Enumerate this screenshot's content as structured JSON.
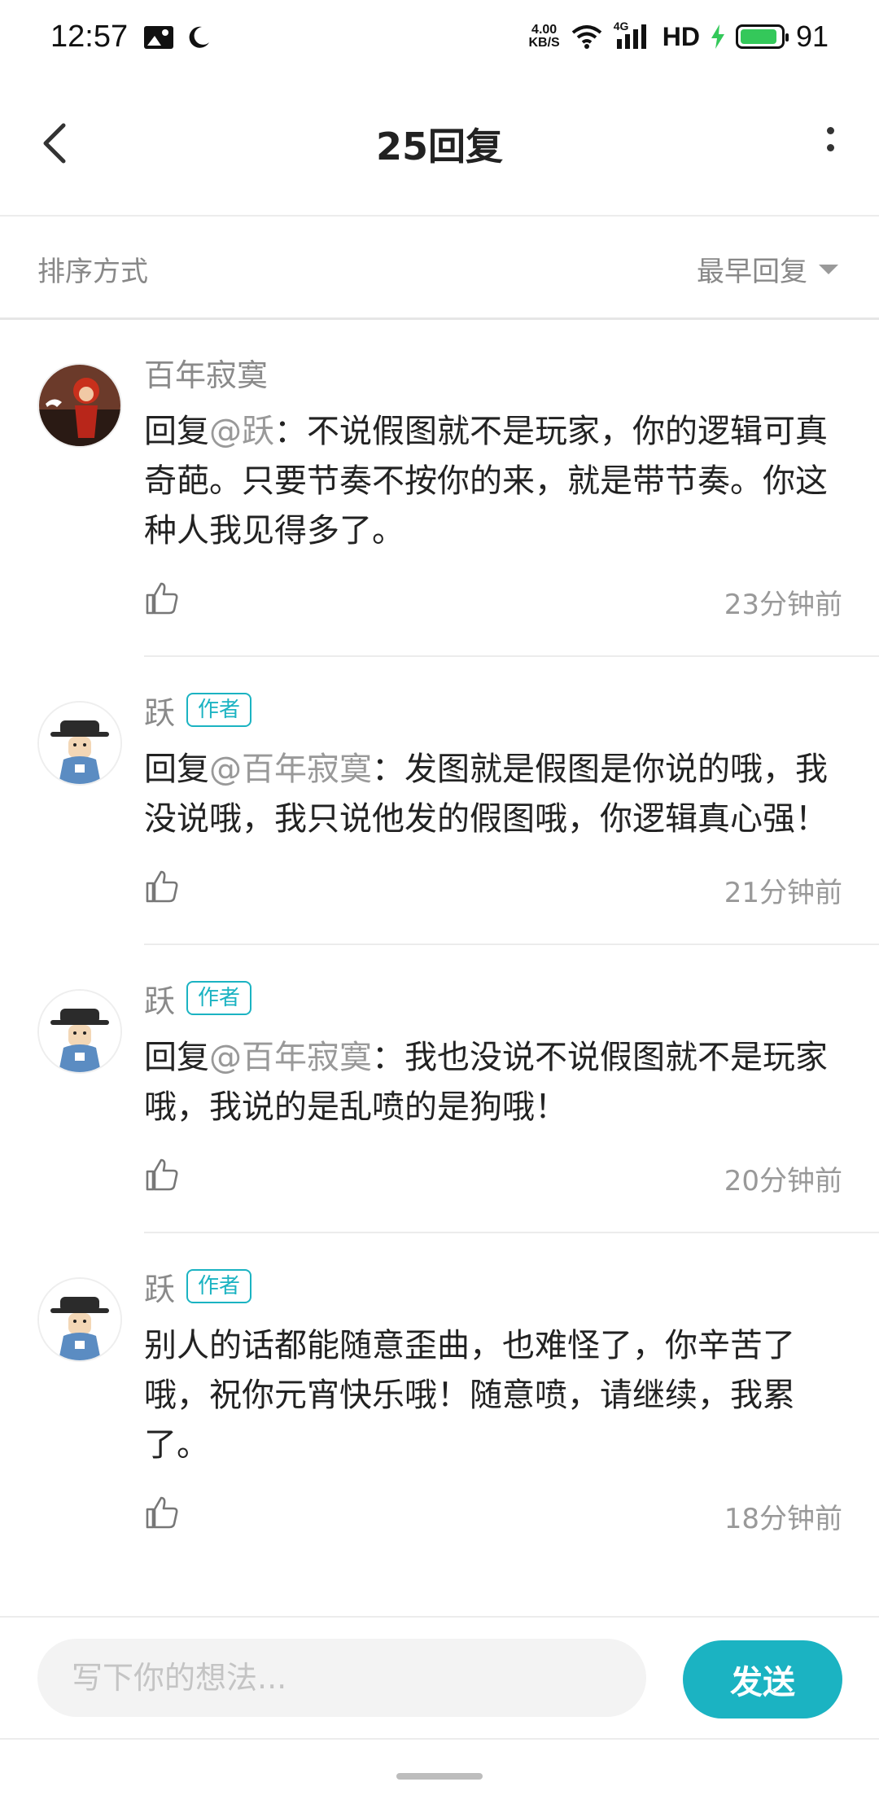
{
  "status_bar": {
    "time": "12:57",
    "net_speed_value": "4.00",
    "net_speed_unit": "KB/S",
    "network": "4G",
    "hd": "HD",
    "battery": "91"
  },
  "header": {
    "title": "25回复"
  },
  "sort": {
    "label": "排序方式",
    "value": "最早回复"
  },
  "comments": [
    {
      "author": "百年寂寞",
      "badge": "",
      "prefix": "回复",
      "mention": "@跃",
      "text": "：不说假图就不是玩家，你的逻辑可真奇葩。只要节奏不按你的来，就是带节奏。你这种人我见得多了。",
      "time": "23分钟前"
    },
    {
      "author": "跃",
      "badge": "作者",
      "prefix": "回复",
      "mention": "@百年寂寞",
      "text": "：发图就是假图是你说的哦，我没说哦，我只说他发的假图哦，你逻辑真心强！",
      "time": "21分钟前"
    },
    {
      "author": "跃",
      "badge": "作者",
      "prefix": "回复",
      "mention": "@百年寂寞",
      "text": "：我也没说不说假图就不是玩家哦，我说的是乱喷的是狗哦！",
      "time": "20分钟前"
    },
    {
      "author": "跃",
      "badge": "作者",
      "prefix": "",
      "mention": "",
      "text": "别人的话都能随意歪曲，也难怪了，你辛苦了哦，祝你元宵快乐哦！随意喷，请继续，我累了。",
      "time": "18分钟前"
    }
  ],
  "input": {
    "placeholder": "写下你的想法..."
  },
  "send_label": "发送",
  "colors": {
    "accent": "#1bb3c2",
    "battery": "#34c85a"
  }
}
